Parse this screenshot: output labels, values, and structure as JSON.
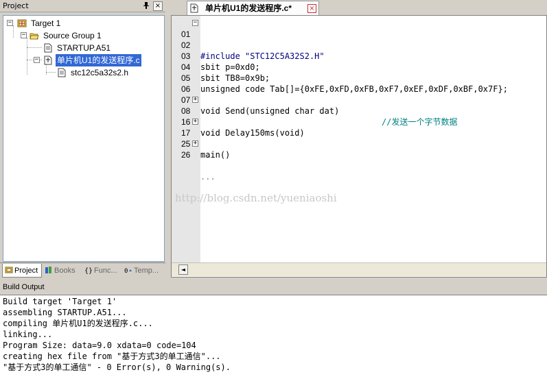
{
  "project_panel": {
    "title": "Project",
    "pin_icon": "pin-icon",
    "close_symbol": "×",
    "tree": {
      "target": "Target 1",
      "source_group": "Source Group 1",
      "files": [
        "STARTUP.A51",
        "单片机U1的发送程序.c"
      ],
      "include_file": "stc12c5a32s2.h",
      "expand_symbol": "−",
      "collapse_symbol": "+"
    },
    "tabs": [
      "Project",
      "Books",
      "Func...",
      "Temp..."
    ]
  },
  "editor": {
    "tab_label": "单片机U1的发送程序.c*",
    "tab_close": "×",
    "lines": [
      {
        "n": "01",
        "fold": "−",
        "code": "#include \"STC12C5A32S2.H\""
      },
      {
        "n": "02",
        "fold": "",
        "code": ""
      },
      {
        "n": "03",
        "fold": "",
        "code": "sbit p=0xd0;"
      },
      {
        "n": "04",
        "fold": "",
        "code": "sbit TB8=0x9b;"
      },
      {
        "n": "05",
        "fold": "",
        "code": "unsigned code Tab[]={0xFE,0xFD,0xFB,0xF7,0xEF,0xDF,0xBF,0x7F};"
      },
      {
        "n": "06",
        "fold": "",
        "code": ""
      },
      {
        "n": "07",
        "fold": "",
        "code": "void Send(unsigned char dat)",
        "comment": "//发送一个字节数据"
      },
      {
        "n": "08",
        "fold": "+",
        "code": "..."
      },
      {
        "n": "16",
        "fold": "",
        "code": "void Delay150ms(void)"
      },
      {
        "n": "17",
        "fold": "+",
        "code": "..."
      },
      {
        "n": "25",
        "fold": "",
        "code": "main()"
      },
      {
        "n": "26",
        "fold": "+",
        "code": "..."
      }
    ],
    "watermark": "http://blog.csdn.net/yueniaoshi",
    "scroll_left": "◄"
  },
  "build_output": {
    "title": "Build Output",
    "lines": [
      "Build target 'Target 1'",
      "assembling STARTUP.A51...",
      "compiling 单片机U1的发送程序.c...",
      "linking...",
      "Program Size: data=9.0 xdata=0 code=104",
      "creating hex file from \"基于方式3的单工通信\"...",
      "\"基于方式3的单工通信\" - 0 Error(s), 0 Warning(s)."
    ]
  },
  "colors": {
    "selection": "#3168d5",
    "comment": "#008080",
    "literal": "#000080",
    "tab_close": "#c03030"
  }
}
